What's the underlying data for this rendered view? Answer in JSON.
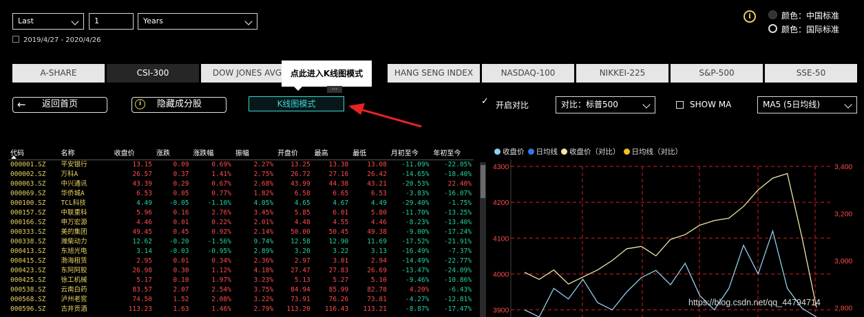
{
  "filters": {
    "period": "Last",
    "count": "1",
    "unit": "Years",
    "date_range": "2019/4/27 - 2020/4/26"
  },
  "color_scheme": {
    "option_cn": "颜色：中国标准",
    "option_intl": "颜色：国际标准",
    "selected": "cn"
  },
  "tabs": [
    "A-SHARE",
    "CSI-300",
    "DOW JONES AVG",
    "HANG SENG INDEX",
    "NASDAQ-100",
    "NIKKEI-225",
    "S&P-500",
    "SSE-50"
  ],
  "active_tab": "CSI-300",
  "tooltip": {
    "text": "点此进入K线图模式",
    "more": "..."
  },
  "actions": {
    "back": "返回首页",
    "hide": "隐藏成分股",
    "kline": "K线图模式"
  },
  "compare": {
    "enable_label": "开启对比",
    "enabled": true,
    "target": "对比：标普500"
  },
  "ma": {
    "show_label": "SHOW MA",
    "checked": false,
    "selected": "MA5 (5日均线)"
  },
  "table": {
    "headers": [
      "代码",
      "名称",
      "收盘价",
      "涨跌",
      "涨跌幅",
      "振幅",
      "开盘价",
      "最高",
      "最低",
      "月初至今",
      "年初至今"
    ],
    "rows": [
      [
        "000001.SZ",
        "平安银行",
        "13.15",
        "0.09",
        "0.69%",
        "2.27%",
        "13.25",
        "13.38",
        "13.08",
        "-11.09%",
        "-22.05%"
      ],
      [
        "000002.SZ",
        "万科A",
        "26.57",
        "0.37",
        "1.41%",
        "2.75%",
        "26.72",
        "27.16",
        "26.42",
        "-14.65%",
        "-18.40%"
      ],
      [
        "000063.SZ",
        "中兴通讯",
        "43.39",
        "0.29",
        "0.67%",
        "2.68%",
        "43.99",
        "44.38",
        "43.21",
        "-20.53%",
        "22.40%"
      ],
      [
        "000069.SZ",
        "华侨城A",
        "6.53",
        "0.05",
        "0.77%",
        "1.82%",
        "6.58",
        "6.65",
        "6.53",
        "-3.83%",
        "-16.07%"
      ],
      [
        "000100.SZ",
        "TCL科技",
        "4.49",
        "-0.05",
        "-1.10%",
        "4.05%",
        "4.65",
        "4.67",
        "4.49",
        "-29.40%",
        "-1.75%"
      ],
      [
        "000157.SZ",
        "中联重科",
        "5.96",
        "0.16",
        "2.76%",
        "3.45%",
        "5.85",
        "6.01",
        "5.80",
        "-11.70%",
        "-13.25%"
      ],
      [
        "000166.SZ",
        "申万宏源",
        "4.46",
        "0.01",
        "0.22%",
        "2.01%",
        "4.48",
        "4.55",
        "4.46",
        "-8.23%",
        "-13.40%"
      ],
      [
        "000333.SZ",
        "美的集团",
        "49.45",
        "0.45",
        "0.92%",
        "2.14%",
        "50.00",
        "50.45",
        "49.38",
        "-9.00%",
        "-17.24%"
      ],
      [
        "000338.SZ",
        "潍柴动力",
        "12.62",
        "-0.20",
        "-1.56%",
        "9.74%",
        "12.58",
        "12.90",
        "11.69",
        "-17.52%",
        "-21.91%"
      ],
      [
        "000413.SZ",
        "东旭光电",
        "3.14",
        "-0.03",
        "-0.95%",
        "2.89%",
        "3.20",
        "3.22",
        "3.13",
        "-16.49%",
        "-7.37%"
      ],
      [
        "000415.SZ",
        "渤海租赁",
        "2.95",
        "0.01",
        "0.34%",
        "2.36%",
        "2.97",
        "3.01",
        "2.94",
        "-14.49%",
        "-22.77%"
      ],
      [
        "000423.SZ",
        "东阿阿胶",
        "26.98",
        "0.30",
        "1.12%",
        "4.18%",
        "27.47",
        "27.83",
        "26.69",
        "-13.47%",
        "-24.09%"
      ],
      [
        "000425.SZ",
        "徐工机械",
        "5.17",
        "0.10",
        "1.97%",
        "3.23%",
        "5.13",
        "5.27",
        "5.10",
        "-9.46%",
        "-10.86%"
      ],
      [
        "000538.SZ",
        "云南白药",
        "83.57",
        "2.07",
        "2.54%",
        "3.75%",
        "84.94",
        "85.99",
        "82.78",
        "4.20%",
        "-6.43%"
      ],
      [
        "000568.SZ",
        "泸州老窖",
        "74.50",
        "1.52",
        "2.08%",
        "3.22%",
        "73.91",
        "76.26",
        "73.81",
        "-4.27%",
        "-12.81%"
      ],
      [
        "000596.SZ",
        "古井贡酒",
        "113.23",
        "1.63",
        "1.46%",
        "2.79%",
        "113.20",
        "116.43",
        "113.21",
        "-8.87%",
        "-17.47%"
      ]
    ]
  },
  "chart_legend": [
    {
      "label": "收盘价",
      "color": "#8fd0f0"
    },
    {
      "label": "日均线",
      "color": "#2c7be5"
    },
    {
      "label": "收盘价（对比）",
      "color": "#f0e6a8"
    },
    {
      "label": "日均线（对比）",
      "color": "#f0c020"
    }
  ],
  "chart_data": {
    "type": "line",
    "left_axis_ticks": [
      "4300",
      "4200",
      "4100",
      "4000",
      "3900"
    ],
    "left_ylim": [
      3880,
      4300
    ],
    "right_axis_ticks": [
      "3,400",
      "3,200",
      "3,000",
      "2,800"
    ],
    "right_ylim": [
      2760,
      3400
    ],
    "grid": true,
    "series": [
      {
        "name": "收盘价",
        "axis": "left",
        "values": [
          3900,
          3880,
          3960,
          3930,
          3985,
          3920,
          3900,
          3950,
          3990,
          4010,
          3970,
          4030,
          3940,
          3900,
          3960,
          4080,
          4000,
          4120,
          3960,
          3905,
          3880
        ]
      },
      {
        "name": "收盘价（对比）",
        "axis": "right",
        "values": [
          2950,
          2920,
          2960,
          2900,
          2930,
          2960,
          3000,
          3050,
          3060,
          3020,
          3090,
          3110,
          3150,
          3170,
          3180,
          3230,
          3300,
          3350,
          3370,
          3100,
          2800
        ]
      }
    ]
  },
  "watermark": "https://blog.csdn.net/qq_44794714"
}
